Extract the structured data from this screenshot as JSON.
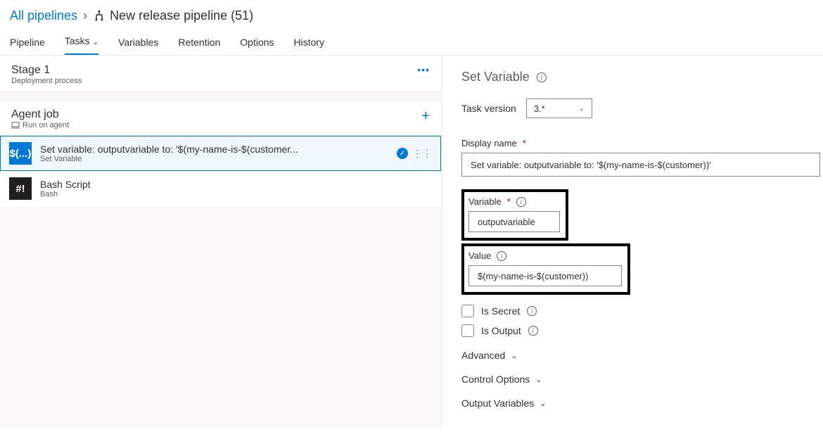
{
  "breadcrumb": {
    "root": "All pipelines",
    "name": "New release pipeline (51)"
  },
  "tabs": {
    "pipeline": "Pipeline",
    "tasks": "Tasks",
    "variables": "Variables",
    "retention": "Retention",
    "options": "Options",
    "history": "History"
  },
  "stage": {
    "title": "Stage 1",
    "subtitle": "Deployment process"
  },
  "agent": {
    "title": "Agent job",
    "subtitle": "Run on agent"
  },
  "tasks_list": {
    "setvar_title": "Set variable: outputvariable to: '$(my-name-is-$(customer...",
    "setvar_sub": "Set Variable",
    "setvar_icon": "$(...)",
    "bash_title": "Bash Script",
    "bash_sub": "Bash",
    "bash_icon": "#!"
  },
  "details": {
    "panel_title": "Set Variable",
    "task_version_label": "Task version",
    "task_version_value": "3.*",
    "display_name_label": "Display name",
    "display_name_value": "Set variable: outputvariable to: '$(my-name-is-$(customer))'",
    "variable_label": "Variable",
    "variable_value": "outputvariable",
    "value_label": "Value",
    "value_value": "$(my-name-is-$(customer))",
    "is_secret_label": "Is Secret",
    "is_output_label": "Is Output",
    "advanced": "Advanced",
    "control_options": "Control Options",
    "output_variables": "Output Variables"
  }
}
